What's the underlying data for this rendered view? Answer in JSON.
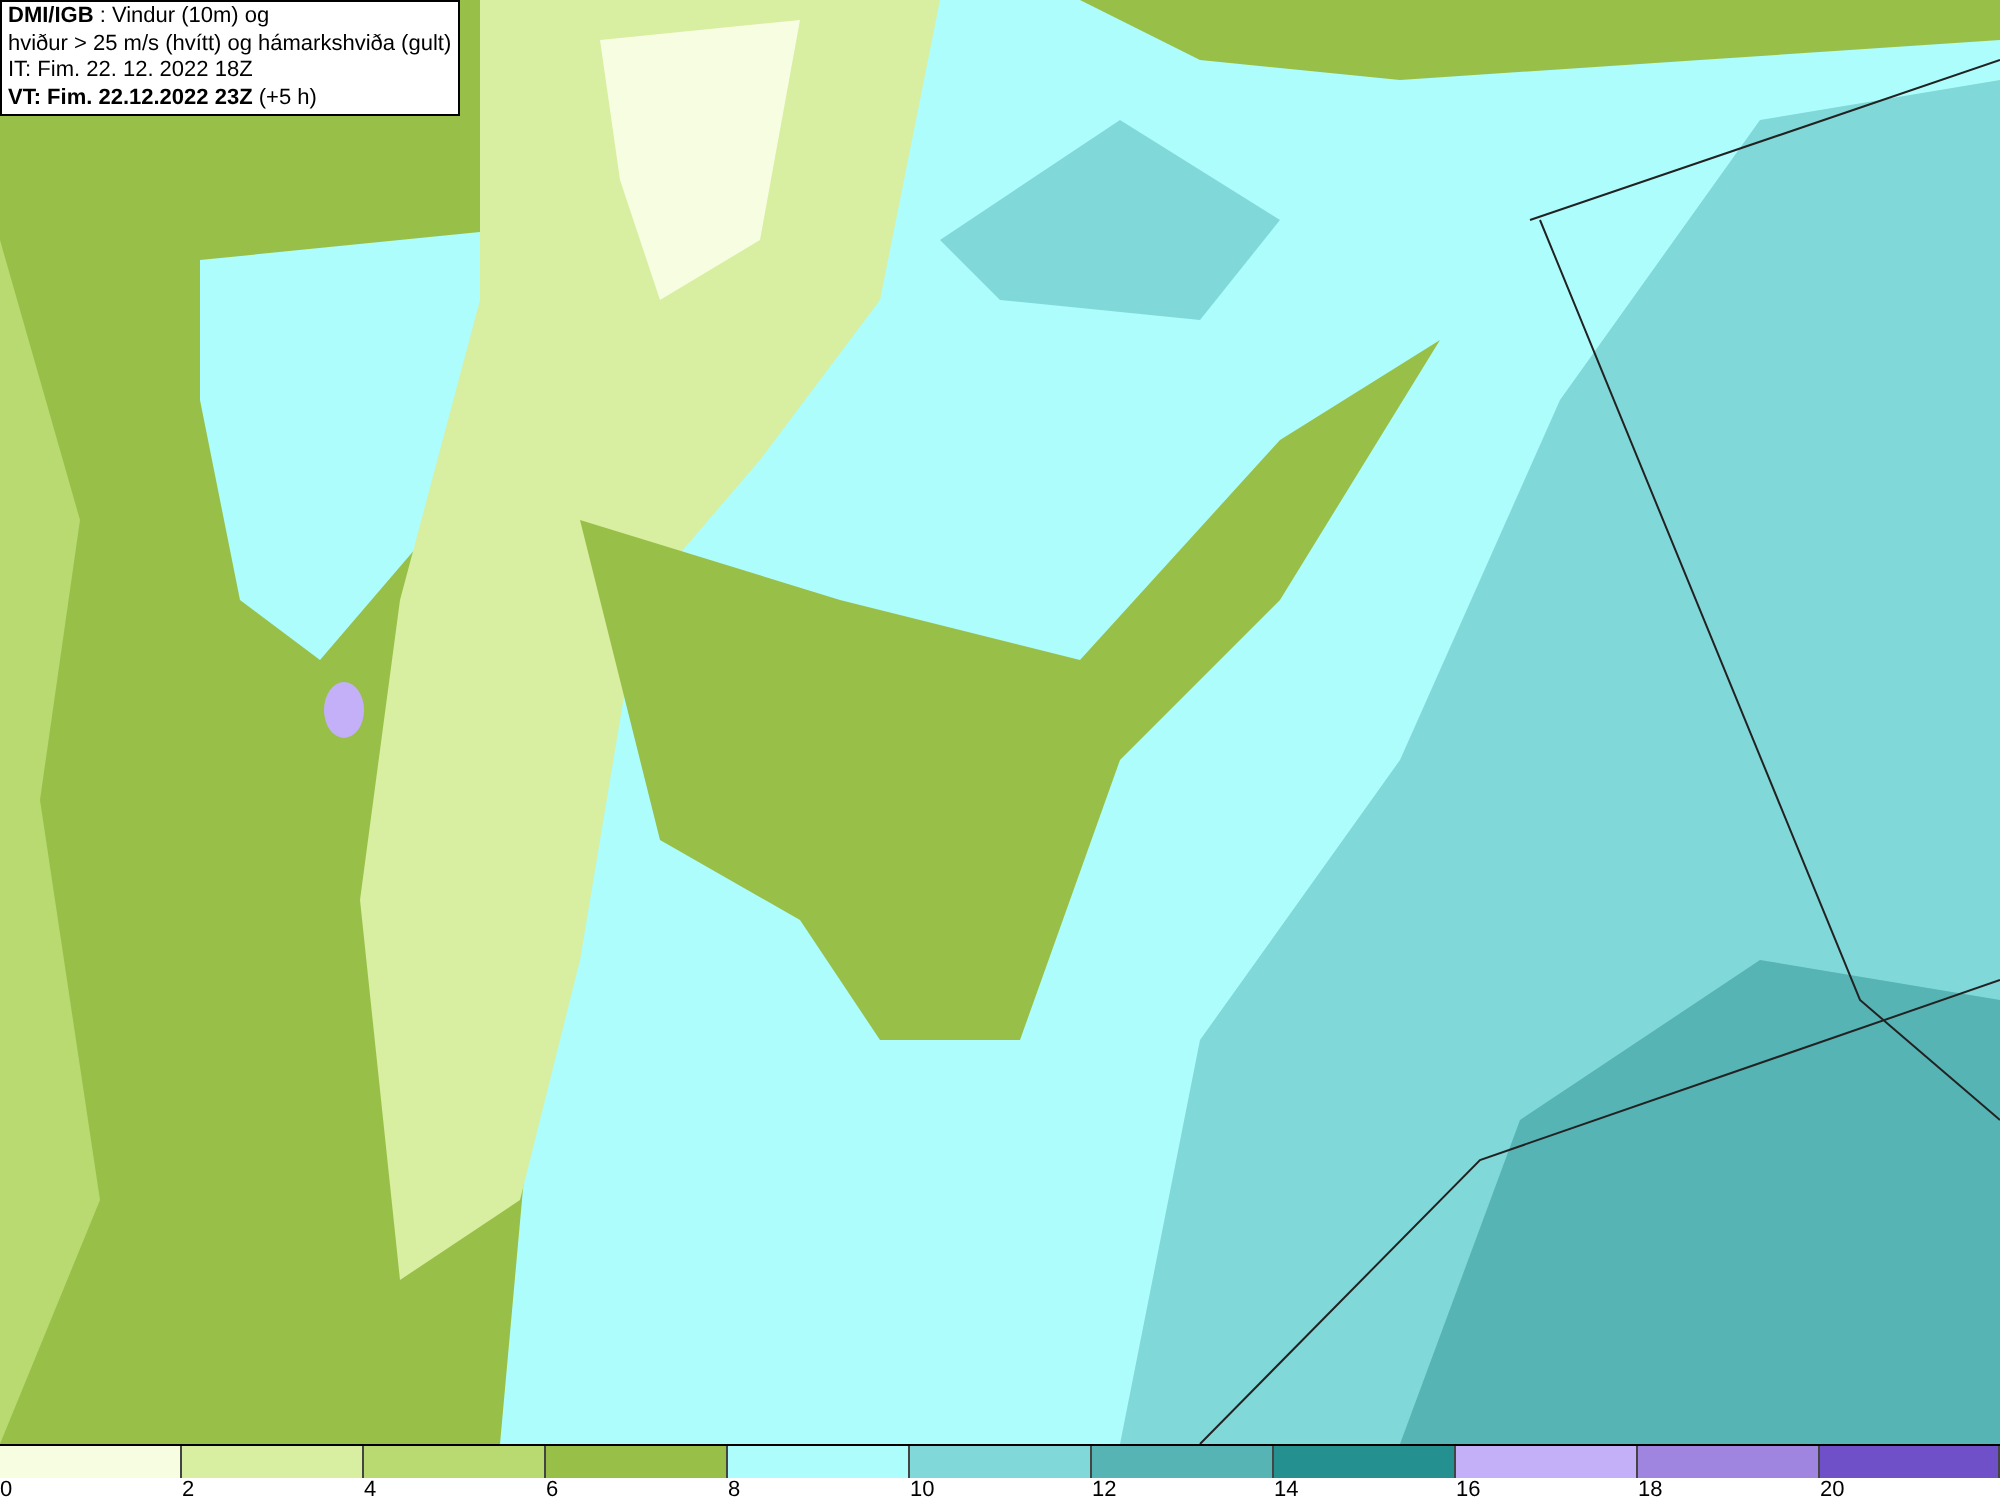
{
  "title_box": {
    "lines": [
      "**DMI/IGB** : Vindur (10m) og",
      "hviður > 25 m/s (hvítt) og hámarkshviða (gult)",
      "IT: Fim. 22. 12. 2022 18Z",
      "**VT: Fim. 22.12.2022 23Z** (+5 h)"
    ]
  },
  "legend": [
    {
      "label": "0",
      "color": "#f7fde0"
    },
    {
      "label": "2",
      "color": "#d8eea0"
    },
    {
      "label": "4",
      "color": "#b8da70"
    },
    {
      "label": "6",
      "color": "#98bf48"
    },
    {
      "label": "8",
      "color": "#aefdfd"
    },
    {
      "label": "10",
      "color": "#80d8d8"
    },
    {
      "label": "12",
      "color": "#56b4b4"
    },
    {
      "label": "14",
      "color": "#249090"
    },
    {
      "label": "16",
      "color": "#c4b0f8"
    },
    {
      "label": "18",
      "color": "#9f84e0"
    },
    {
      "label": "20",
      "color": "#7050c8"
    }
  ]
}
